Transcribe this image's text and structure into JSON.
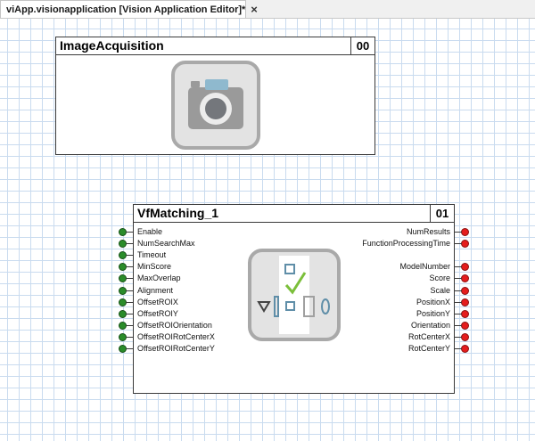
{
  "tab": {
    "title": "viApp.visionapplication [Vision Application Editor]*",
    "close": "×"
  },
  "blocks": {
    "image_acquisition": {
      "title": "ImageAcquisition",
      "id": "00"
    },
    "vf_matching": {
      "title": "VfMatching_1",
      "id": "01",
      "inputs": [
        "Enable",
        "NumSearchMax",
        "Timeout",
        "MinScore",
        "MaxOverlap",
        "Alignment",
        "OffsetROIX",
        "OffsetROIY",
        "OffsetROIOrientation",
        "OffsetROIRotCenterX",
        "OffsetROIRotCenterY"
      ],
      "outputs": [
        "NumResults",
        "FunctionProcessingTime",
        "",
        "ModelNumber",
        "Score",
        "Scale",
        "PositionX",
        "PositionY",
        "Orientation",
        "RotCenterX",
        "RotCenterY"
      ]
    }
  },
  "colors": {
    "input_pin": "#2a8c2a",
    "output_pin": "#e51d1d",
    "grid": "#c9dbef"
  }
}
